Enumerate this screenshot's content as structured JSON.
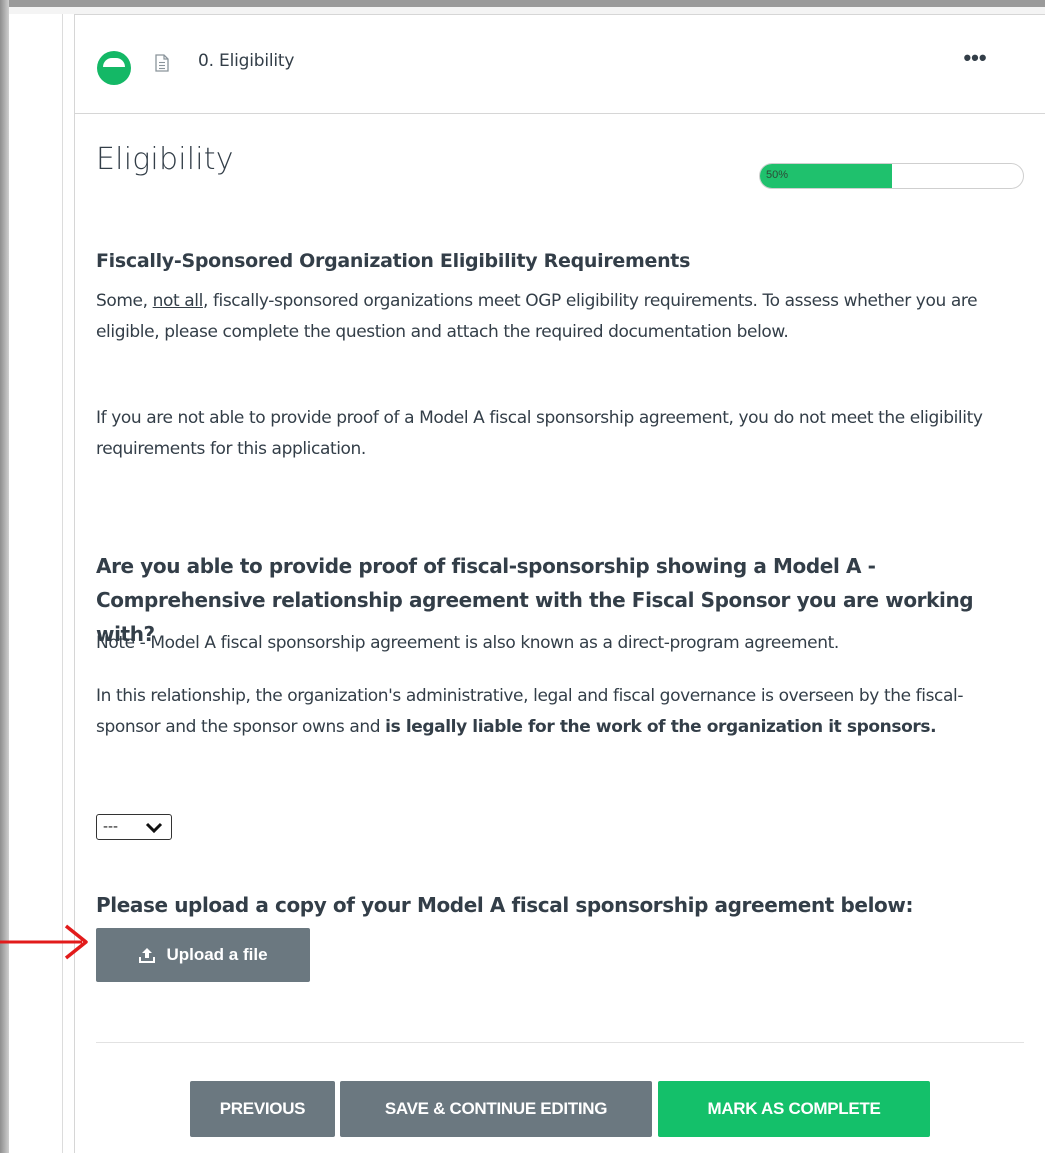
{
  "header": {
    "section_name": "0. Eligibility",
    "more_label": "•••",
    "icons": [
      "status-half-circle-icon",
      "document-icon",
      "more-icon"
    ]
  },
  "page": {
    "title": "Eligibility",
    "progress": {
      "percent": 50,
      "label": "50%",
      "color": "#1fc16d"
    }
  },
  "intro": {
    "heading": "Fiscally-Sponsored Organization Eligibility Requirements",
    "para1_before": "Some, ",
    "para1_underline": "not all",
    "para1_after": ", fiscally-sponsored organizations meet OGP eligibility requirements. To assess whether you are eligible, please complete the question and attach the required documentation below.",
    "para2": "If you are not able to provide proof of a Model A fiscal sponsorship agreement, you do not meet the eligibility requirements for this application."
  },
  "question": {
    "text": "Are you able to provide proof of fiscal-sponsorship showing a Model A - Comprehensive relationship agreement with the Fiscal Sponsor you are working with?",
    "note": "Note - Model A fiscal sponsorship agreement is also known as a direct-program agreement.",
    "detail_before": "In this relationship, the organization's administrative, legal and fiscal governance is overseen by the fiscal-sponsor and the sponsor owns and ",
    "detail_bold": "is legally liable for the work of the organization it sponsors.",
    "select_value": "---"
  },
  "upload": {
    "heading": "Please upload a copy of your Model A fiscal sponsorship agreement below:",
    "button_label": "Upload a file",
    "icon": "upload-icon"
  },
  "footer": {
    "previous_label": "PREVIOUS",
    "save_label": "SAVE & CONTINUE EDITING",
    "complete_label": "MARK AS COMPLETE"
  },
  "colors": {
    "primary_green": "#14c06a",
    "button_gray": "#6b7880",
    "text": "#333e48",
    "annotation_arrow": "#e21b1b"
  }
}
